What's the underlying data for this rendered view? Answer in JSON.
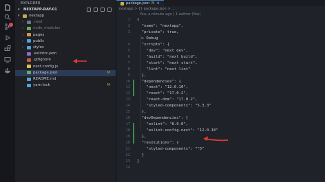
{
  "sidebar": {
    "title": "EXPLORER",
    "workspace": "NEXTAPP-DAY-01",
    "tree": [
      {
        "label": "nextapp",
        "kind": "folder",
        "depth": 1,
        "open": true,
        "color": "#c9a55a",
        "modified": ""
      },
      {
        "label": ".next",
        "kind": "folder",
        "depth": 2,
        "open": false,
        "color": "#6d7a8a",
        "modified": "",
        "dim": true
      },
      {
        "label": "node_modules",
        "kind": "folder",
        "depth": 2,
        "open": false,
        "color": "#6cab59",
        "modified": "",
        "dim": true
      },
      {
        "label": "pages",
        "kind": "folder",
        "depth": 2,
        "open": false,
        "color": "#d6934a",
        "modified": ""
      },
      {
        "label": "public",
        "kind": "folder",
        "depth": 2,
        "open": false,
        "color": "#4fa4d6",
        "modified": ""
      },
      {
        "label": "styles",
        "kind": "folder",
        "depth": 2,
        "open": false,
        "color": "#5aa0d8",
        "modified": ""
      },
      {
        "label": ".eslintrc.json",
        "kind": "file",
        "depth": 2,
        "color": "#8a6bd0",
        "modified": ""
      },
      {
        "label": ".gitignore",
        "kind": "file",
        "depth": 2,
        "color": "#d0573f",
        "modified": ""
      },
      {
        "label": "next.config.js",
        "kind": "file",
        "depth": 2,
        "color": "#d9c24a",
        "modified": ""
      },
      {
        "label": "package.json",
        "kind": "file",
        "depth": 2,
        "color": "#6cab59",
        "modified": "M",
        "selected": true
      },
      {
        "label": "README.md",
        "kind": "file",
        "depth": 2,
        "color": "#4fa4d6",
        "modified": ""
      },
      {
        "label": "yarn.lock",
        "kind": "file",
        "depth": 2,
        "color": "#4fa4d6",
        "modified": "M"
      }
    ]
  },
  "editor": {
    "tab": {
      "label": "package.json",
      "modified": "M",
      "close": "×"
    },
    "breadcrumb": "nextapp > {} package.json > ...",
    "codelens": "You, a minute ago | 1 author (You)",
    "lines": [
      {
        "n": "1",
        "text": "{"
      },
      {
        "n": "2",
        "text": "  \"name\": \"nextapp\","
      },
      {
        "n": "3",
        "text": "  \"private\": true,"
      },
      {
        "n": "",
        "text": "  ▷ Debug",
        "mini": true
      },
      {
        "n": "4",
        "text": "  \"scripts\": {"
      },
      {
        "n": "5",
        "text": "    \"dev\": \"next dev\","
      },
      {
        "n": "6",
        "text": "    \"build\": \"next build\","
      },
      {
        "n": "7",
        "text": "    \"start\": \"next start\","
      },
      {
        "n": "8",
        "text": "    \"lint\": \"next lint\""
      },
      {
        "n": "9",
        "text": "  },"
      },
      {
        "n": "10",
        "text": "  \"dependencies\": {"
      },
      {
        "n": "11",
        "text": "    \"next\": \"12.0.10\","
      },
      {
        "n": "12",
        "text": "    \"react\": \"17.0.2\","
      },
      {
        "n": "13",
        "text": "    \"react-dom\": \"17.0.2\","
      },
      {
        "n": "14",
        "text": "    \"styled-components\": \"5.3.3\""
      },
      {
        "n": "15",
        "text": "  },"
      },
      {
        "n": "16",
        "text": "  \"devDependencies\": {"
      },
      {
        "n": "17",
        "text": "    \"eslint\": \"8.9.0\","
      },
      {
        "n": "18",
        "text": "    \"eslint-config-next\": \"12.0.10\""
      },
      {
        "n": "19",
        "text": "  },"
      },
      {
        "n": "20",
        "text": "  \"resolutions\": {"
      },
      {
        "n": "21",
        "text": "    \"styled-components\": \"^5\""
      },
      {
        "n": "22",
        "text": "  }"
      },
      {
        "n": "23",
        "text": "}"
      },
      {
        "n": "24",
        "text": ""
      }
    ]
  },
  "colors": {
    "accent": "#3f86d6",
    "annotation_arrow": "#e23a3a",
    "git_added": "#3a8d4b",
    "modified": "#b9a44b"
  },
  "activity_icons": [
    "files-icon",
    "search-icon",
    "source-control-icon",
    "run-debug-icon",
    "extensions-icon",
    "remote-explorer-icon",
    "docker-icon"
  ]
}
